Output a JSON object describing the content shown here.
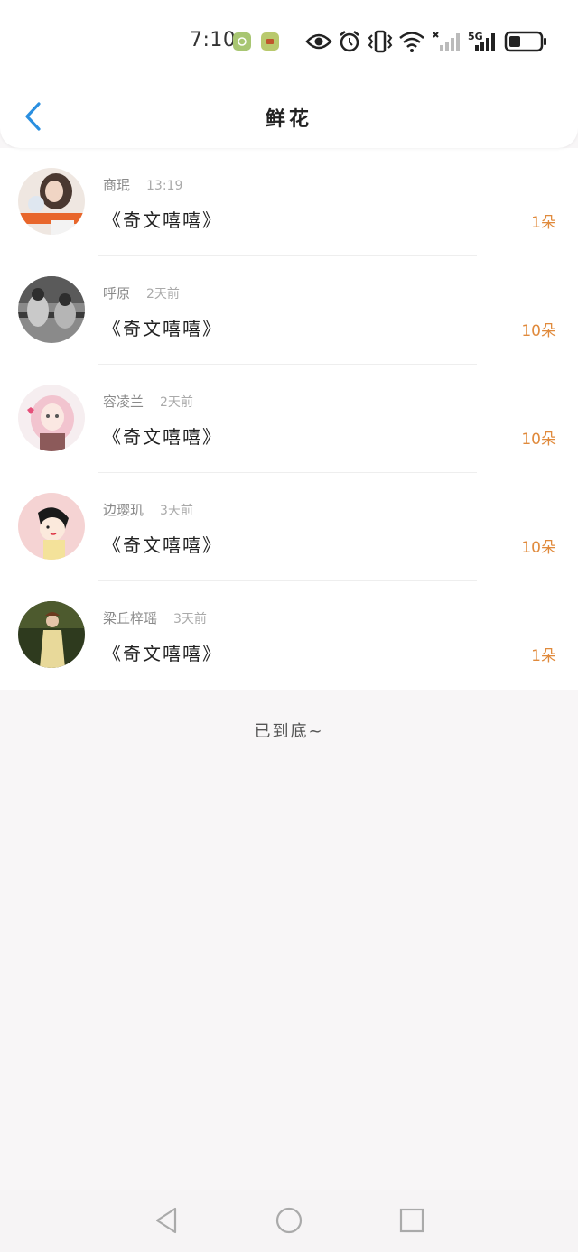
{
  "status_bar": {
    "time": "7:10",
    "network": "5G",
    "icons": [
      "app-notification-icon",
      "app-notification-icon",
      "eye-icon",
      "alarm-icon",
      "vibrate-icon",
      "wifi-icon",
      "signal-off-icon",
      "signal-icon",
      "battery-icon"
    ]
  },
  "header": {
    "title": "鲜花",
    "back_icon": "chevron-left-icon"
  },
  "colors": {
    "accent_blue": "#2a8fe0",
    "flower_count": "#e08a3c"
  },
  "items": [
    {
      "sender": "商珉",
      "time": "13:19",
      "book": "《奇文嘻嘻》",
      "count": "1朵",
      "avatar": "photo-avatar"
    },
    {
      "sender": "呼原",
      "time": "2天前",
      "book": "《奇文嘻嘻》",
      "count": "10朵",
      "avatar": "photo-avatar"
    },
    {
      "sender": "容凌兰",
      "time": "2天前",
      "book": "《奇文嘻嘻》",
      "count": "10朵",
      "avatar": "anime-avatar"
    },
    {
      "sender": "边璎玑",
      "time": "3天前",
      "book": "《奇文嘻嘻》",
      "count": "10朵",
      "avatar": "cartoon-avatar"
    },
    {
      "sender": "梁丘梓瑶",
      "time": "3天前",
      "book": "《奇文嘻嘻》",
      "count": "1朵",
      "avatar": "photo-avatar"
    }
  ],
  "footer": {
    "end_text": "已到底~"
  },
  "system_nav": {
    "buttons": [
      "back-triangle-icon",
      "home-circle-icon",
      "recents-square-icon"
    ]
  }
}
